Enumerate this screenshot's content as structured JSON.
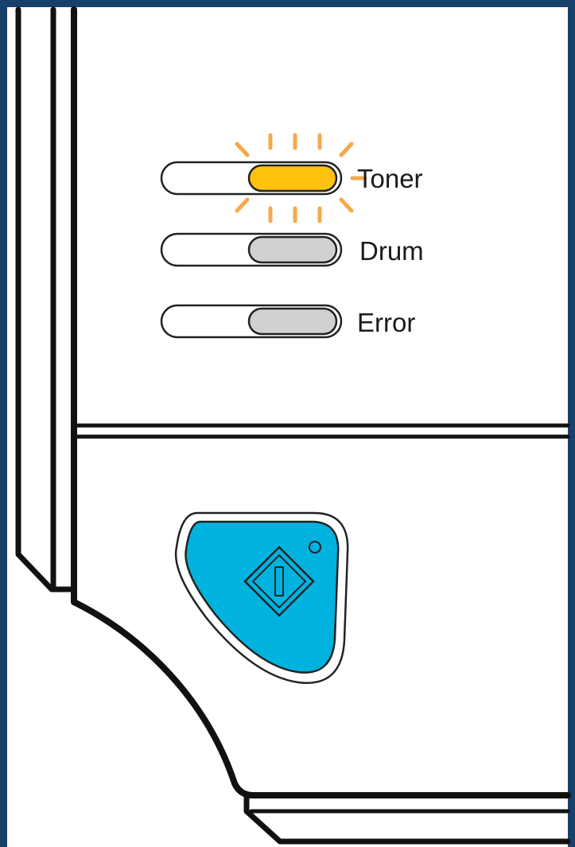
{
  "frame": {
    "border_color": "#17406a"
  },
  "panel": {
    "indicators": [
      {
        "label": "Toner",
        "state": "blinking",
        "lit_color": "#ffc20e",
        "glow_color": "#f5a94b"
      },
      {
        "label": "Drum",
        "state": "off",
        "lit_color": "#cfd1d3"
      },
      {
        "label": "Error",
        "state": "off",
        "lit_color": "#cfd1d3"
      }
    ],
    "go_button": {
      "icon": "diamond-go-icon",
      "color": "#00b2de"
    }
  }
}
